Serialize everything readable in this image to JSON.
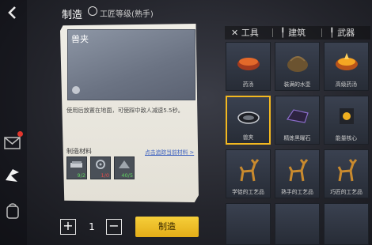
{
  "header": {
    "title": "制造",
    "level": "工匠等级(熟手)"
  },
  "item": {
    "name": "兽夹",
    "description": "使用后放置在地面，可使踩中敌人减速5.5秒。"
  },
  "materials": {
    "label": "制造材料",
    "link": "点击追踪当前材料 >",
    "slots": [
      {
        "name": "metal-scrap",
        "count": "9/2",
        "color": "#5fd25f"
      },
      {
        "name": "gear-part",
        "count": "1/0",
        "color": "#e04b4b"
      },
      {
        "name": "stone-block",
        "count": "40/5",
        "color": "#5fd25f"
      }
    ]
  },
  "quantity": {
    "minus": "−",
    "plus": "+",
    "value": "1"
  },
  "craft_button": "制造",
  "tabs": [
    {
      "icon": "✕",
      "label": "工具"
    },
    {
      "icon": "╿",
      "label": "建筑"
    },
    {
      "icon": "╿",
      "label": "武器"
    }
  ],
  "grid": [
    {
      "label": "药汤",
      "icon": "soup-bowl-icon"
    },
    {
      "label": "装满的水壶",
      "icon": "water-kettle-icon"
    },
    {
      "label": "高级药汤",
      "icon": "fire-soup-icon"
    },
    {
      "label": "兽夹",
      "icon": "beast-trap-icon",
      "selected": true
    },
    {
      "label": "精炼黑曜石",
      "icon": "obsidian-icon"
    },
    {
      "label": "能量核心",
      "icon": "energy-core-icon"
    },
    {
      "label": "学徒的工艺品",
      "icon": "deer-statue-icon"
    },
    {
      "label": "熟手的工艺品",
      "icon": "deer-statue-icon"
    },
    {
      "label": "巧匠的工艺品",
      "icon": "deer-statue-icon"
    }
  ]
}
